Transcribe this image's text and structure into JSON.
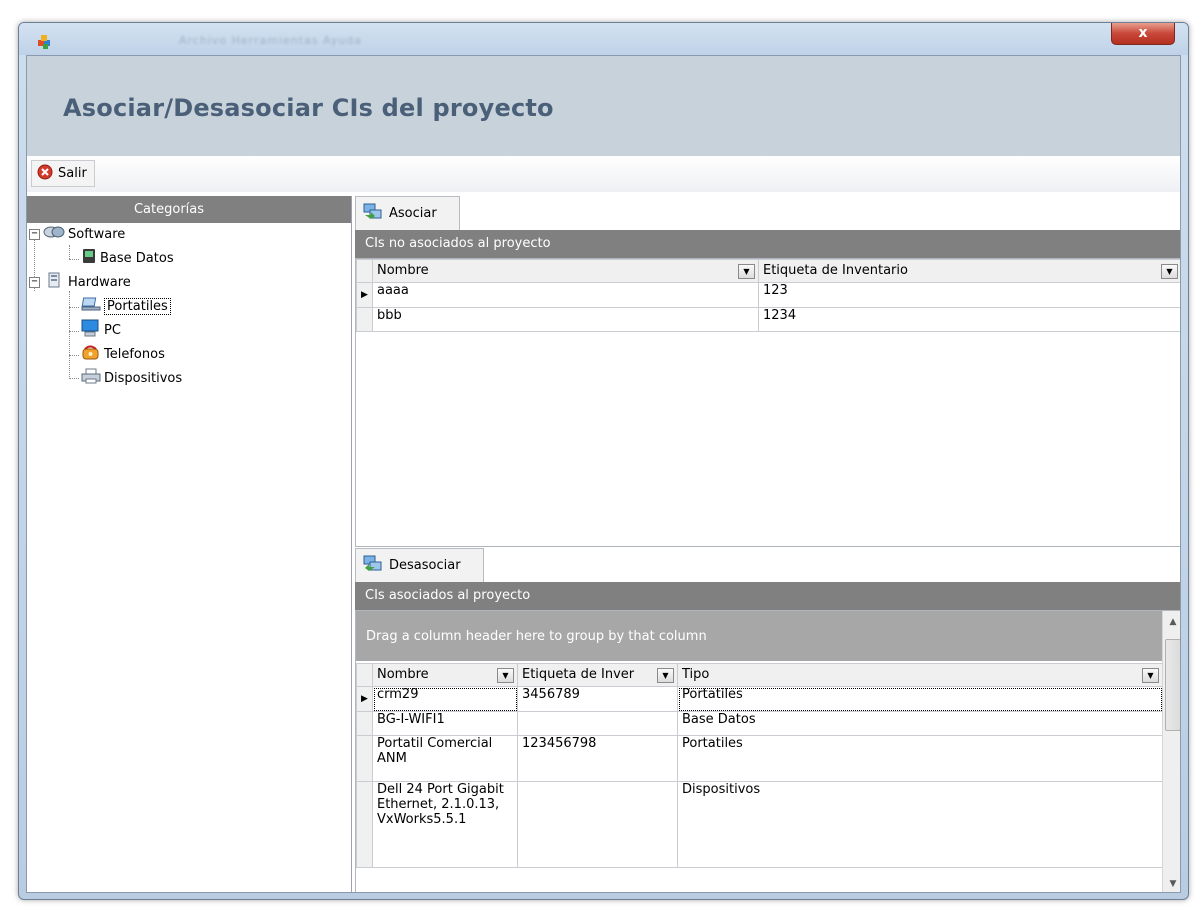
{
  "window": {
    "blurred_menu": "Archivo  Herramientas  Ayuda",
    "close_label": "x",
    "page_title": "Asociar/Desasociar CIs del proyecto"
  },
  "toolbar": {
    "exit_label": "Salir"
  },
  "sidebar": {
    "header": "Categorías",
    "tree": [
      {
        "label": "Software",
        "icon": "software-icon",
        "expanded": true,
        "children": [
          {
            "label": "Base Datos",
            "icon": "database-icon"
          }
        ]
      },
      {
        "label": "Hardware",
        "icon": "hardware-icon",
        "expanded": true,
        "children": [
          {
            "label": "Portatiles",
            "icon": "laptop-icon",
            "selected": true
          },
          {
            "label": "PC",
            "icon": "pc-icon"
          },
          {
            "label": "Telefonos",
            "icon": "phone-icon"
          },
          {
            "label": "Dispositivos",
            "icon": "printer-icon"
          }
        ]
      }
    ]
  },
  "associate": {
    "tab_label": "Asociar",
    "section_title": "CIs no asociados al proyecto",
    "columns": [
      "Nombre",
      "Etiqueta de Inventario"
    ],
    "rows": [
      {
        "nombre": "aaaa",
        "etiqueta": "123",
        "current": true
      },
      {
        "nombre": "bbb",
        "etiqueta": "1234"
      }
    ]
  },
  "dissociate": {
    "tab_label": "Desasociar",
    "section_title": "CIs asociados al proyecto",
    "group_hint": "Drag a column header here to group by that column",
    "columns": [
      "Nombre",
      "Etiqueta de Inver",
      "Tipo"
    ],
    "rows": [
      {
        "nombre": "crm29",
        "etiqueta": "3456789",
        "tipo": "Portatiles",
        "current": true
      },
      {
        "nombre": "BG-I-WIFI1",
        "etiqueta": "",
        "tipo": "Base Datos"
      },
      {
        "nombre": "Portatil Comercial ANM",
        "etiqueta": "123456798",
        "tipo": "Portatiles"
      },
      {
        "nombre": "Dell 24 Port Gigabit Ethernet, 2.1.0.13, VxWorks5.5.1",
        "etiqueta": "",
        "tipo": "Dispositivos"
      }
    ]
  },
  "colors": {
    "header_bg": "#c8d2db",
    "title_text": "#4a5f78",
    "panel_header": "#808080",
    "group_area": "#a7a7a7",
    "close_button": "#c8473a"
  }
}
